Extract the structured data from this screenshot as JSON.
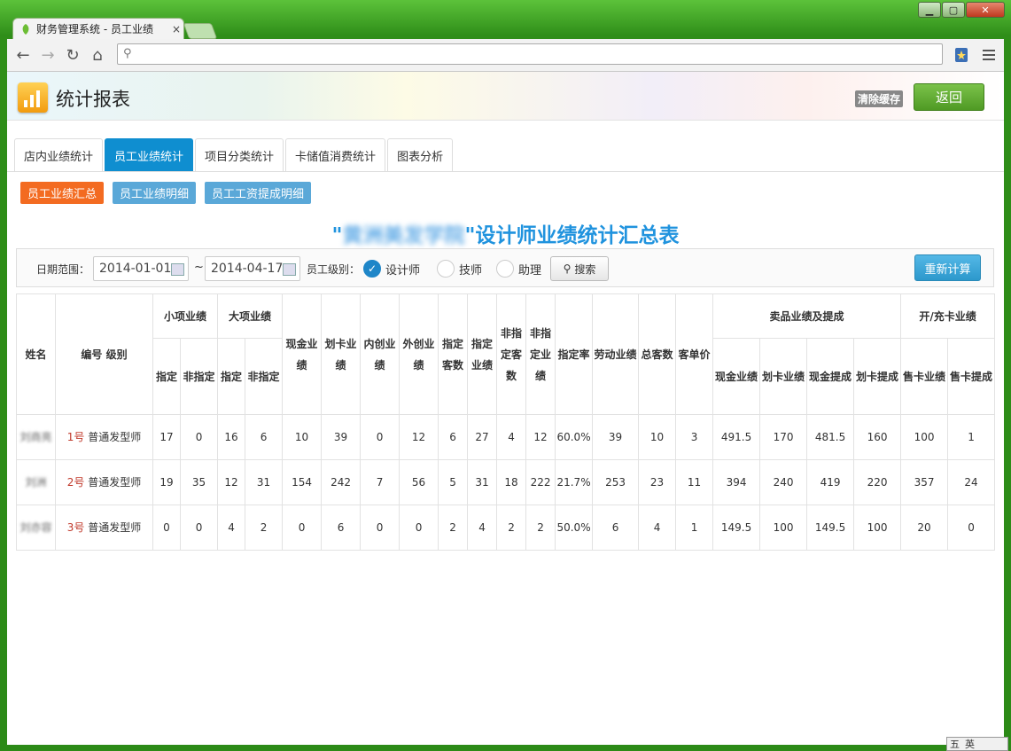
{
  "browser": {
    "tab_title": "财务管理系统 - 员工业绩",
    "tab_close": "×",
    "address": "",
    "min_glyph": "▁",
    "max_glyph": "▢",
    "close_glyph": "✕"
  },
  "header": {
    "title": "统计报表",
    "clear_cache": "清除缓存",
    "back": "返回"
  },
  "tabs": [
    {
      "label": "店内业绩统计",
      "active": false
    },
    {
      "label": "员工业绩统计",
      "active": true
    },
    {
      "label": "项目分类统计",
      "active": false
    },
    {
      "label": "卡储值消费统计",
      "active": false
    },
    {
      "label": "图表分析",
      "active": false
    }
  ],
  "subbuttons": [
    {
      "label": "员工业绩汇总",
      "active": true
    },
    {
      "label": "员工业绩明细",
      "active": false
    },
    {
      "label": "员工工资提成明细",
      "active": false
    }
  ],
  "report": {
    "quote_open": "\"",
    "org_name": "黄洲美发学院",
    "quote_close": "\"",
    "title_suffix": "设计师业绩统计汇总表"
  },
  "filter": {
    "date_label": "日期范围：",
    "date_from": "2014-01-01",
    "tilde": "~",
    "date_to": "2014-04-17",
    "level_label": "员工级别：",
    "levels": [
      {
        "label": "设计师",
        "checked": true
      },
      {
        "label": "技师",
        "checked": false
      },
      {
        "label": "助理",
        "checked": false
      }
    ],
    "search": "搜索",
    "recalc": "重新计算"
  },
  "table": {
    "headers": {
      "name": "姓名",
      "id_level": "编号 级别",
      "small": "小项业绩",
      "big": "大项业绩",
      "cash": "现金业绩",
      "card": "划卡业绩",
      "inner": "内创业绩",
      "outer": "外创业绩",
      "assign_cust": "指定客数",
      "assign_perf": "指定业绩",
      "nonassign_cust": "非指定客数",
      "nonassign_perf": "非指定业绩",
      "assign_rate": "指定率",
      "labor": "劳动业绩",
      "total_cust": "总客数",
      "unit_price": "客单价",
      "product": "卖品业绩及提成",
      "cardsale": "开/充卡业绩",
      "sub_assign": "指定",
      "sub_nonassign": "非指定",
      "prod_cash": "现金业绩",
      "prod_card": "划卡业绩",
      "prod_cash_comm": "现金提成",
      "prod_card_comm": "划卡提成",
      "card_sale_perf": "售卡业绩",
      "card_sale_comm": "售卡提成"
    },
    "rows": [
      {
        "name": "刘商亮",
        "num": "1号",
        "level": "普通发型师",
        "small_a": "17",
        "small_n": "0",
        "big_a": "16",
        "big_n": "6",
        "cash": "10",
        "card": "39",
        "inner": "0",
        "outer": "12",
        "ac": "6",
        "ap": "27",
        "nc": "4",
        "np": "12",
        "rate": "60.0%",
        "labor": "39",
        "total": "10",
        "unit": "3",
        "pc": "491.5",
        "pk": "170",
        "pcc": "481.5",
        "pkc": "160",
        "sp": "100",
        "sc": "1"
      },
      {
        "name": "刘洲",
        "num": "2号",
        "level": "普通发型师",
        "small_a": "19",
        "small_n": "35",
        "big_a": "12",
        "big_n": "31",
        "cash": "154",
        "card": "242",
        "inner": "7",
        "outer": "56",
        "ac": "5",
        "ap": "31",
        "nc": "18",
        "np": "222",
        "rate": "21.7%",
        "labor": "253",
        "total": "23",
        "unit": "11",
        "pc": "394",
        "pk": "240",
        "pcc": "419",
        "pkc": "220",
        "sp": "357",
        "sc": "24"
      },
      {
        "name": "刘亦容",
        "num": "3号",
        "level": "普通发型师",
        "small_a": "0",
        "small_n": "0",
        "big_a": "4",
        "big_n": "2",
        "cash": "0",
        "card": "6",
        "inner": "0",
        "outer": "0",
        "ac": "2",
        "ap": "4",
        "nc": "2",
        "np": "2",
        "rate": "50.0%",
        "labor": "6",
        "total": "4",
        "unit": "1",
        "pc": "149.5",
        "pk": "100",
        "pcc": "149.5",
        "pkc": "100",
        "sp": "20",
        "sc": "0"
      }
    ]
  },
  "ime": {
    "a": "五",
    "b": "英"
  },
  "colors": {
    "accent": "#0f8ed0",
    "orange": "#f36b21",
    "green": "#4f9a24",
    "title_blue": "#2093de"
  }
}
